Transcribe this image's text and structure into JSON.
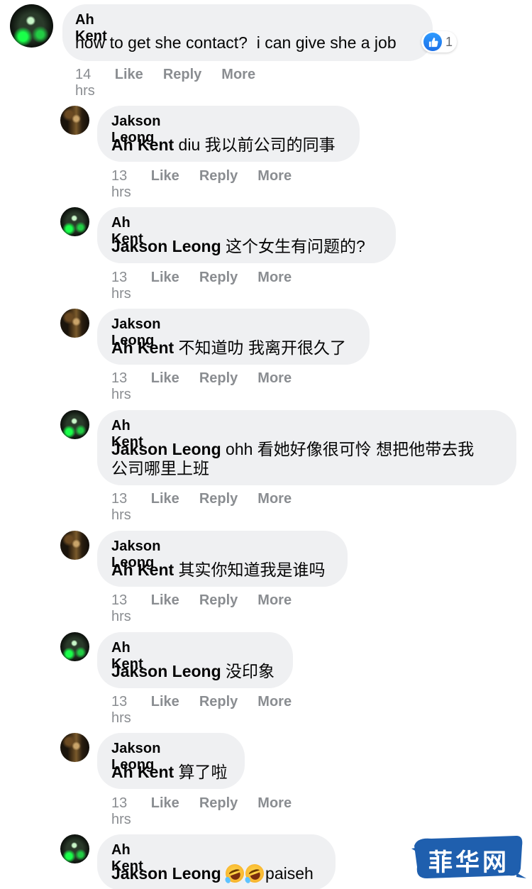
{
  "comments": [
    {
      "author": "Ah Kent",
      "mention": "",
      "text": "how to get she contact?  i can give she a job",
      "time": "14 hrs",
      "reaction_count": "1"
    },
    {
      "author": "Jakson Leong",
      "mention": "Ah Kent",
      "text": " diu 我以前公司的同事",
      "time": "13 hrs"
    },
    {
      "author": "Ah Kent",
      "mention": "Jakson Leong",
      "text": " 这个女生有问题的?",
      "time": "13 hrs"
    },
    {
      "author": "Jakson Leong",
      "mention": "Ah Kent",
      "text": " 不知道叻 我离开很久了",
      "time": "13 hrs"
    },
    {
      "author": "Ah Kent",
      "mention": "Jakson Leong",
      "text_line1": " ohh 看她好像很可怜 想把他带去我",
      "text_line2": "公司哪里上班",
      "time": "13 hrs"
    },
    {
      "author": "Jakson Leong",
      "mention": "Ah Kent",
      "text": " 其实你知道我是谁吗",
      "time": "13 hrs"
    },
    {
      "author": "Ah Kent",
      "mention": "Jakson Leong",
      "text": " 没印象",
      "time": "13 hrs"
    },
    {
      "author": "Jakson Leong",
      "mention": "Ah Kent",
      "text": " 算了啦",
      "time": "13 hrs"
    },
    {
      "author": "Ah Kent",
      "mention": "Jakson Leong",
      "text": "paiseh",
      "time": ""
    }
  ],
  "actions": {
    "like": "Like",
    "reply": "Reply",
    "more": "More"
  },
  "icons": {
    "reaction": "like-icon",
    "emoji": "rolling-on-floor-laughing-emoji"
  },
  "colors": {
    "bubble": "#eff0f2",
    "meta": "#8a8d91",
    "like_blue": "#1b74e4",
    "watermark": "#1f5fae"
  },
  "watermark": {
    "text": "菲华网"
  }
}
